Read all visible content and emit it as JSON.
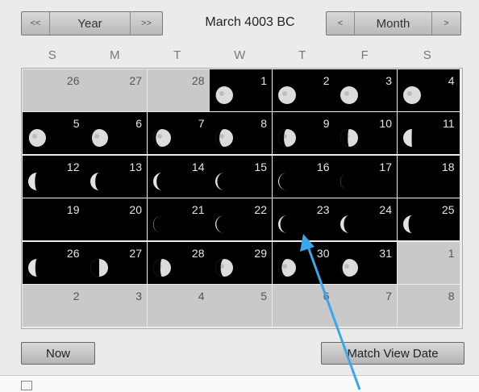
{
  "nav": {
    "year_prev": "<<",
    "year_label": "Year",
    "year_next": ">>",
    "month_prev": "<",
    "month_label": "Month",
    "month_next": ">"
  },
  "title": "March 4003 BC",
  "days_of_week": [
    "S",
    "M",
    "T",
    "W",
    "T",
    "F",
    "S"
  ],
  "weeks": [
    [
      {
        "day": "26",
        "in_month": false,
        "phase": null
      },
      {
        "day": "27",
        "in_month": false,
        "phase": null
      },
      {
        "day": "28",
        "in_month": false,
        "phase": null
      },
      {
        "day": "1",
        "in_month": true,
        "phase": 0.97
      },
      {
        "day": "2",
        "in_month": true,
        "phase": 0.99
      },
      {
        "day": "3",
        "in_month": true,
        "phase": 1.0
      },
      {
        "day": "4",
        "in_month": true,
        "phase": 0.99
      }
    ],
    [
      {
        "day": "5",
        "in_month": true,
        "phase": 0.96
      },
      {
        "day": "6",
        "in_month": true,
        "phase": 0.91
      },
      {
        "day": "7",
        "in_month": true,
        "phase": 0.85
      },
      {
        "day": "8",
        "in_month": true,
        "phase": 0.77
      },
      {
        "day": "9",
        "in_month": true,
        "phase": 0.68
      },
      {
        "day": "10",
        "in_month": true,
        "phase": 0.58
      },
      {
        "day": "11",
        "in_month": true,
        "phase": 0.48
      }
    ],
    [
      {
        "day": "12",
        "in_month": true,
        "phase": 0.38
      },
      {
        "day": "13",
        "in_month": true,
        "phase": 0.28
      },
      {
        "day": "14",
        "in_month": true,
        "phase": 0.19
      },
      {
        "day": "15",
        "in_month": true,
        "phase": 0.11
      },
      {
        "day": "16",
        "in_month": true,
        "phase": 0.05
      },
      {
        "day": "17",
        "in_month": true,
        "phase": 0.01
      },
      {
        "day": "18",
        "in_month": true,
        "phase": 0.0
      }
    ],
    [
      {
        "day": "19",
        "in_month": true,
        "phase": 0.0
      },
      {
        "day": "20",
        "in_month": true,
        "phase": 0.0
      },
      {
        "day": "21",
        "in_month": true,
        "phase": 0.02
      },
      {
        "day": "22",
        "in_month": true,
        "phase": 0.06
      },
      {
        "day": "23",
        "in_month": true,
        "phase": 0.12
      },
      {
        "day": "24",
        "in_month": true,
        "phase": 0.2
      },
      {
        "day": "25",
        "in_month": true,
        "phase": 0.3
      }
    ],
    [
      {
        "day": "26",
        "in_month": true,
        "phase": 0.4
      },
      {
        "day": "27",
        "in_month": true,
        "phase": 0.5
      },
      {
        "day": "28",
        "in_month": true,
        "phase": 0.6
      },
      {
        "day": "29",
        "in_month": true,
        "phase": 0.7
      },
      {
        "day": "30",
        "in_month": true,
        "phase": 0.8
      },
      {
        "day": "31",
        "in_month": true,
        "phase": 0.88
      },
      {
        "day": "1",
        "in_month": false,
        "phase": null
      }
    ],
    [
      {
        "day": "2",
        "in_month": false,
        "phase": null
      },
      {
        "day": "3",
        "in_month": false,
        "phase": null
      },
      {
        "day": "4",
        "in_month": false,
        "phase": null
      },
      {
        "day": "5",
        "in_month": false,
        "phase": null
      },
      {
        "day": "6",
        "in_month": false,
        "phase": null
      },
      {
        "day": "7",
        "in_month": false,
        "phase": null
      },
      {
        "day": "8",
        "in_month": false,
        "phase": null
      }
    ]
  ],
  "buttons": {
    "now": "Now",
    "match_view_date": "Match View Date"
  },
  "colors": {
    "annotation_arrow": "#3aa7ea",
    "dark_cell": "#000000",
    "outside_month_cell": "#c9c9c9"
  }
}
